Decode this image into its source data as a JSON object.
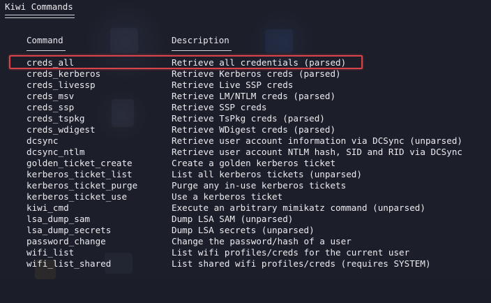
{
  "terminal": {
    "title": "Kiwi Commands",
    "headers": {
      "command": "Command",
      "description": "Description"
    },
    "highlight_color": "#d8444a",
    "rows": [
      {
        "command": "creds_all",
        "description": "Retrieve all credentials (parsed)"
      },
      {
        "command": "creds_kerberos",
        "description": "Retrieve Kerberos creds (parsed)"
      },
      {
        "command": "creds_livessp",
        "description": "Retrieve Live SSP creds"
      },
      {
        "command": "creds_msv",
        "description": "Retrieve LM/NTLM creds (parsed)"
      },
      {
        "command": "creds_ssp",
        "description": "Retrieve SSP creds"
      },
      {
        "command": "creds_tspkg",
        "description": "Retrieve TsPkg creds (parsed)"
      },
      {
        "command": "creds_wdigest",
        "description": "Retrieve WDigest creds (parsed)"
      },
      {
        "command": "dcsync",
        "description": "Retrieve user account information via DCSync (unparsed)"
      },
      {
        "command": "dcsync_ntlm",
        "description": "Retrieve user account NTLM hash, SID and RID via DCSync"
      },
      {
        "command": "golden_ticket_create",
        "description": "Create a golden kerberos ticket"
      },
      {
        "command": "kerberos_ticket_list",
        "description": "List all kerberos tickets (unparsed)"
      },
      {
        "command": "kerberos_ticket_purge",
        "description": "Purge any in-use kerberos tickets"
      },
      {
        "command": "kerberos_ticket_use",
        "description": "Use a kerberos ticket"
      },
      {
        "command": "kiwi_cmd",
        "description": "Execute an arbitrary mimikatz command (unparsed)"
      },
      {
        "command": "lsa_dump_sam",
        "description": "Dump LSA SAM (unparsed)"
      },
      {
        "command": "lsa_dump_secrets",
        "description": "Dump LSA secrets (unparsed)"
      },
      {
        "command": "password_change",
        "description": "Change the password/hash of a user"
      },
      {
        "command": "wifi_list",
        "description": "List wifi profiles/creds for the current user"
      },
      {
        "command": "wifi_list_shared",
        "description": "List shared wifi profiles/creds (requires SYSTEM)"
      }
    ]
  }
}
